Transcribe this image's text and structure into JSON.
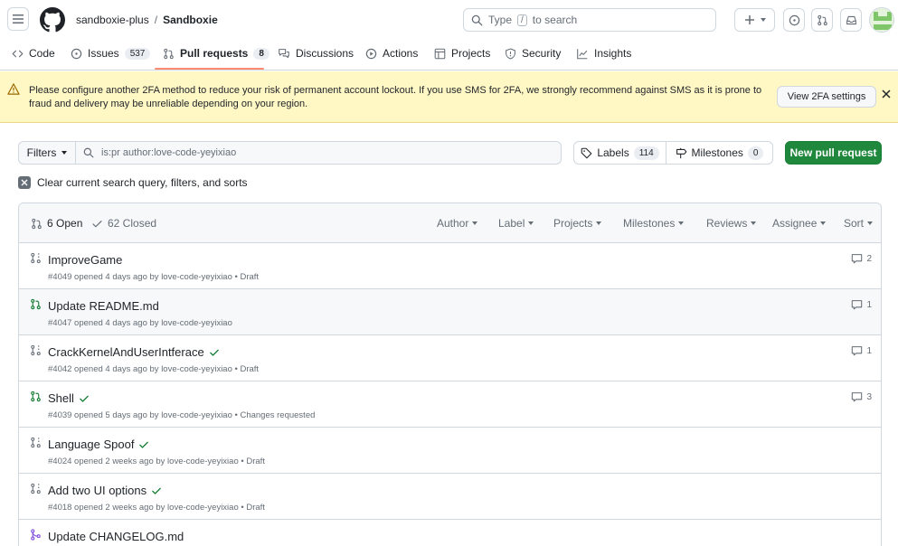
{
  "header": {
    "owner": "sandboxie-plus",
    "separator": "/",
    "repo": "Sandboxie",
    "search_prefix": "Type",
    "search_key": "/",
    "search_suffix": "to search"
  },
  "tabs": [
    {
      "label": "Code",
      "icon": "code-icon"
    },
    {
      "label": "Issues",
      "icon": "issue-icon",
      "count": "537"
    },
    {
      "label": "Pull requests",
      "icon": "pull-request-icon",
      "count": "8",
      "selected": true
    },
    {
      "label": "Discussions",
      "icon": "discussion-icon"
    },
    {
      "label": "Actions",
      "icon": "play-icon"
    },
    {
      "label": "Projects",
      "icon": "table-icon"
    },
    {
      "label": "Security",
      "icon": "shield-icon"
    },
    {
      "label": "Insights",
      "icon": "graph-icon"
    }
  ],
  "banner": {
    "line1": "Please configure another 2FA method to reduce your risk of permanent account lockout. If you use SMS for 2FA, we strongly recommend against SMS as it is prone to",
    "line2": "fraud and delivery may be unreliable depending on your region.",
    "button": "View 2FA settings"
  },
  "filters": {
    "button": "Filters",
    "query": "is:pr author:love-code-yeyixiao",
    "labels": "Labels",
    "labels_count": "114",
    "milestones": "Milestones",
    "milestones_count": "0",
    "new_pr": "New pull request",
    "clear": "Clear current search query, filters, and sorts"
  },
  "list": {
    "open": "6 Open",
    "closed": "62 Closed",
    "sorts": [
      "Author",
      "Label",
      "Projects",
      "Milestones",
      "Reviews",
      "Assignee",
      "Sort"
    ],
    "rows": [
      {
        "title": "ImproveGame",
        "meta": "#4049 opened 4 days ago by love-code-yeyixiao • Draft",
        "comments": "2",
        "state": "draft",
        "check": false
      },
      {
        "title": "Update README.md",
        "meta": "#4047 opened 4 days ago by love-code-yeyixiao",
        "comments": "1",
        "state": "open",
        "check": false
      },
      {
        "title": "CrackKernelAndUserIntferace",
        "meta": "#4042 opened 4 days ago by love-code-yeyixiao • Draft",
        "comments": "1",
        "state": "draft",
        "check": true
      },
      {
        "title": "Shell",
        "meta": "#4039 opened 5 days ago by love-code-yeyixiao • Changes requested",
        "comments": "3",
        "state": "open",
        "check": true
      },
      {
        "title": "Language Spoof",
        "meta": "#4024 opened 2 weeks ago by love-code-yeyixiao • Draft",
        "comments": "",
        "state": "draft",
        "check": true
      },
      {
        "title": "Add two UI options",
        "meta": "#4018 opened 2 weeks ago by love-code-yeyixiao • Draft",
        "comments": "",
        "state": "draft",
        "check": true
      },
      {
        "title": "Update CHANGELOG.md",
        "meta": "",
        "comments": "",
        "state": "merged",
        "check": false
      }
    ]
  },
  "colors": {
    "accent_green": "#1f883d",
    "open_green": "#1a7f37",
    "merged_purple": "#8250df",
    "draft_gray": "#656d76",
    "banner_yellow": "#fff8c5",
    "tab_underline": "#fd8c73"
  }
}
